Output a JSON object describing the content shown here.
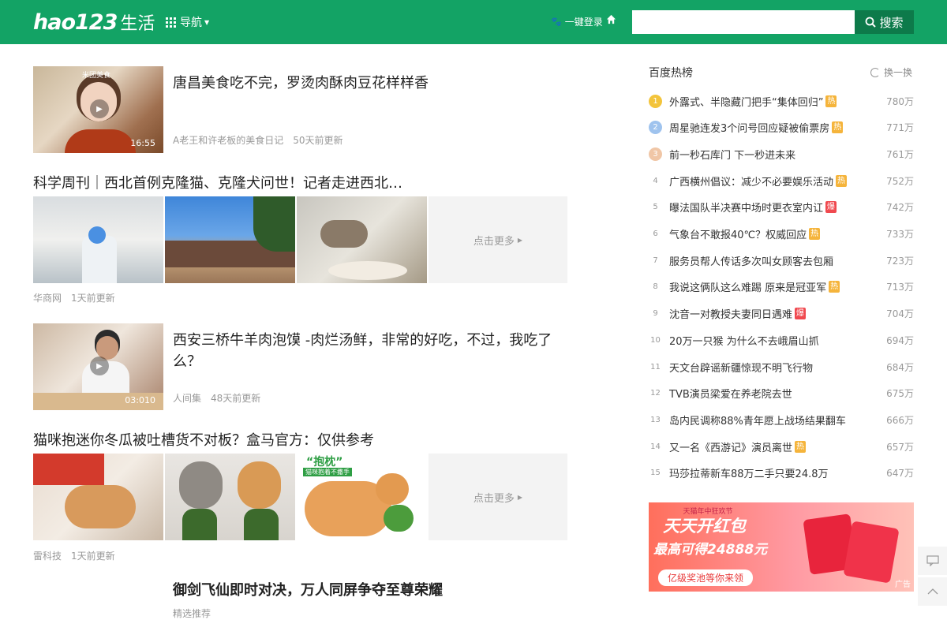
{
  "header": {
    "logo_en": "hao123",
    "logo_cn": "生活",
    "nav_label": "导航",
    "login_label": "一键登录",
    "search_placeholder": "",
    "search_button": "搜索",
    "bg_color": "#13a365"
  },
  "feed": [
    {
      "title": "唐昌美食吃不完，罗烫肉酥肉豆花样样香",
      "source": "A老王和许老板的美食日记",
      "time": "50天前更新",
      "duration": "16:55",
      "thumb_text": "米团美食"
    },
    {
      "title": "科学周刊｜西北首例克隆猫、克隆犬问世！记者走进西北…",
      "source": "华商网",
      "time": "1天前更新",
      "more": "点击更多"
    },
    {
      "title": "西安三桥牛羊肉泡馍 -肉烂汤鲜，非常的好吃，不过，我吃了么？",
      "source": "人间集",
      "time": "48天前更新",
      "duration": "03:010"
    },
    {
      "title": "猫咪抱迷你冬瓜被吐槽货不对板？盒马官方：仅供参考",
      "source": "雷科技",
      "time": "1天前更新",
      "more": "点击更多",
      "thumb_text": "“抱枕”",
      "thumb_sub": "猫咪抱着不撒手"
    },
    {
      "title": "御剑飞仙即时对决，万人同屏争夺至尊荣耀",
      "source": "精选推荐"
    }
  ],
  "sidebar": {
    "title": "百度热榜",
    "refresh_label": "换一换",
    "items": [
      {
        "rank": "1",
        "text": "外露式、半隐藏门把手“集体回归”",
        "tag": "热",
        "tag_type": "hot",
        "num": "780万"
      },
      {
        "rank": "2",
        "text": "周星驰连发3个问号回应疑被偷票房",
        "tag": "热",
        "tag_type": "hot",
        "num": "771万"
      },
      {
        "rank": "3",
        "text": "前一秒石库门 下一秒进未来",
        "tag": "",
        "tag_type": "",
        "num": "761万"
      },
      {
        "rank": "4",
        "text": "广西横州倡议：减少不必要娱乐活动",
        "tag": "热",
        "tag_type": "hot",
        "num": "752万"
      },
      {
        "rank": "5",
        "text": "曝法国队半决赛中场时更衣室内讧",
        "tag": "爆",
        "tag_type": "bao",
        "num": "742万"
      },
      {
        "rank": "6",
        "text": "气象台不敢报40℃？权威回应",
        "tag": "热",
        "tag_type": "hot",
        "num": "733万"
      },
      {
        "rank": "7",
        "text": "服务员帮人传话多次叫女顾客去包厢",
        "tag": "",
        "tag_type": "",
        "num": "723万"
      },
      {
        "rank": "8",
        "text": "我说这俩队这么难踢 原来是冠亚军",
        "tag": "热",
        "tag_type": "hot",
        "num": "713万"
      },
      {
        "rank": "9",
        "text": "沈音一对教授夫妻同日遇难",
        "tag": "爆",
        "tag_type": "bao",
        "num": "704万"
      },
      {
        "rank": "10",
        "text": "20万一只猴 为什么不去峨眉山抓",
        "tag": "",
        "tag_type": "",
        "num": "694万"
      },
      {
        "rank": "11",
        "text": "天文台辟谣新疆惊现不明飞行物",
        "tag": "",
        "tag_type": "",
        "num": "684万"
      },
      {
        "rank": "12",
        "text": "TVB演员梁爱在养老院去世",
        "tag": "",
        "tag_type": "",
        "num": "675万"
      },
      {
        "rank": "13",
        "text": "岛内民调称88%青年愿上战场结果翻车",
        "tag": "",
        "tag_type": "",
        "num": "666万"
      },
      {
        "rank": "14",
        "text": "又一名《西游记》演员离世",
        "tag": "热",
        "tag_type": "hot",
        "num": "657万"
      },
      {
        "rank": "15",
        "text": "玛莎拉蒂新车88万二手只要24.8万",
        "tag": "",
        "tag_type": "",
        "num": "647万"
      }
    ]
  },
  "ad": {
    "line1": "天猫年中狂欢节",
    "line2": "天天开红包",
    "line3": "最高可得24888元",
    "line4": "亿级奖池等你来领",
    "label": "广告"
  }
}
